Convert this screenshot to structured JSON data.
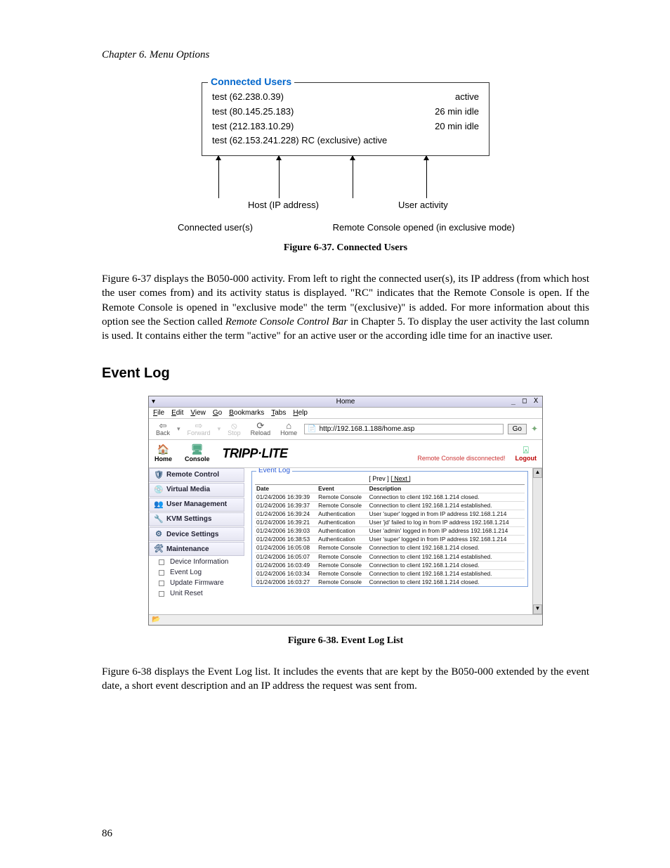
{
  "chapter_header": "Chapter 6. Menu Options",
  "fig37": {
    "fieldset_label": "Connected Users",
    "rows": [
      {
        "left": "test (62.238.0.39)",
        "right": "active"
      },
      {
        "left": "test (80.145.25.183)",
        "right": "26 min idle"
      },
      {
        "left": "test (212.183.10.29)",
        "right": "20 min idle"
      },
      {
        "left": "test (62.153.241.228) RC (exclusive) active",
        "right": ""
      }
    ],
    "annot_host": "Host (IP address)",
    "annot_activity": "User activity",
    "annot_left": "Connected user(s)",
    "annot_right": "Remote Console opened (in exclusive mode)",
    "caption": "Figure 6-37. Connected Users"
  },
  "para1": "Figure 6-37 displays the B050-000 activity. From left to right the connected user(s), its IP address (from which host the user comes from) and its activity status is displayed. \"RC\" indicates that the Remote Console is open. If the Remote Console is opened in \"exclusive mode\" the term \"(exclusive)\" is added. For more information about this option see the Section called ",
  "para1_ital": "Remote Console Control Bar",
  "para1_tail": " in Chapter 5. To display the user activity the last column is used. It contains either the term \"active\" for an active user or the according idle time for an inactive user.",
  "section_title": "Event Log",
  "screenshot": {
    "title": "Home",
    "win_ctrls": "_ □ X",
    "menus": [
      "File",
      "Edit",
      "View",
      "Go",
      "Bookmarks",
      "Tabs",
      "Help"
    ],
    "toolbar": {
      "back": "Back",
      "forward": "Forward",
      "stop": "Stop",
      "reload": "Reload",
      "home": "Home",
      "address": "http://192.168.1.188/home.asp",
      "go": "Go"
    },
    "brand": {
      "home": "Home",
      "console": "Console",
      "logo": "TRIPP·LITE",
      "rc_status": "Remote Console disconnected!",
      "logout": "Logout"
    },
    "sidebar": {
      "items": [
        "Remote Control",
        "Virtual Media",
        "User Management",
        "KVM Settings",
        "Device Settings",
        "Maintenance"
      ],
      "subs": [
        "Device Information",
        "Event Log",
        "Update Firmware",
        "Unit Reset"
      ]
    },
    "eventlog": {
      "fieldset_label": "Event Log",
      "nav_prev": "[ Prev ]",
      "nav_next": "[ Next ]",
      "headers": {
        "date": "Date",
        "event": "Event",
        "desc": "Description"
      },
      "rows": [
        {
          "d": "01/24/2006 16:39:39",
          "e": "Remote Console",
          "s": "Connection to client 192.168.1.214 closed."
        },
        {
          "d": "01/24/2006 16:39:37",
          "e": "Remote Console",
          "s": "Connection to client 192.168.1.214 established."
        },
        {
          "d": "01/24/2006 16:39:24",
          "e": "Authentication",
          "s": "User 'super' logged in from IP address 192.168.1.214"
        },
        {
          "d": "01/24/2006 16:39:21",
          "e": "Authentication",
          "s": "User 'jd' failed to log in from IP address 192.168.1.214"
        },
        {
          "d": "01/24/2006 16:39:03",
          "e": "Authentication",
          "s": "User 'admin' logged in from IP address 192.168.1.214"
        },
        {
          "d": "01/24/2006 16:38:53",
          "e": "Authentication",
          "s": "User 'super' logged in from IP address 192.168.1.214"
        },
        {
          "d": "01/24/2006 16:05:08",
          "e": "Remote Console",
          "s": "Connection to client 192.168.1.214 closed."
        },
        {
          "d": "01/24/2006 16:05:07",
          "e": "Remote Console",
          "s": "Connection to client 192.168.1.214 established."
        },
        {
          "d": "01/24/2006 16:03:49",
          "e": "Remote Console",
          "s": "Connection to client 192.168.1.214 closed."
        },
        {
          "d": "01/24/2006 16:03:34",
          "e": "Remote Console",
          "s": "Connection to client 192.168.1.214 established."
        },
        {
          "d": "01/24/2006 16:03:27",
          "e": "Remote Console",
          "s": "Connection to client 192.168.1.214 closed."
        }
      ]
    },
    "status_icon": "📂"
  },
  "fig38_caption": "Figure 6-38. Event Log List",
  "para2": "Figure 6-38 displays the Event Log list. It includes the events that are kept by the B050-000 extended by the event date, a short event description and an IP address the request was sent from.",
  "page_number": "86"
}
